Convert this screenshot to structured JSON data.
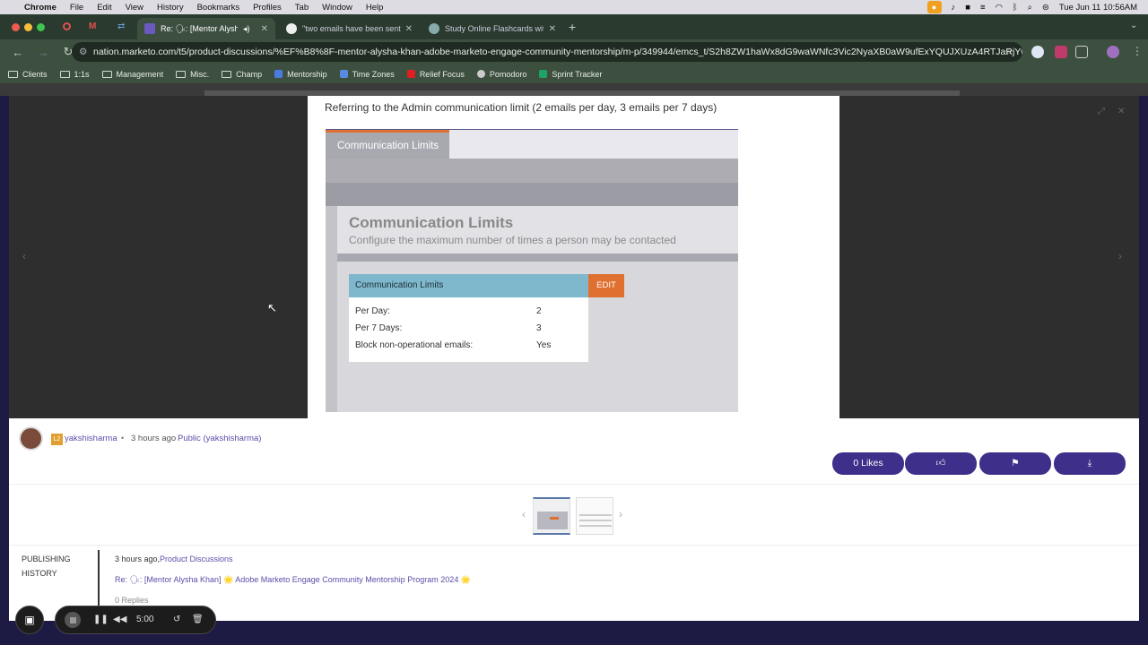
{
  "menubar": {
    "app": "Chrome",
    "items": [
      "File",
      "Edit",
      "View",
      "History",
      "Bookmarks",
      "Profiles",
      "Tab",
      "Window",
      "Help"
    ],
    "datetime": "Tue Jun 11  10:56AM"
  },
  "tabs": [
    {
      "label": "Re: 🗣: [Mentor Alysha Kh"
    },
    {
      "label": "\"two emails have been sent t"
    },
    {
      "label": "Study Online Flashcards with"
    }
  ],
  "address": {
    "url": "nation.marketo.com/t5/product-discussions/%EF%B8%8F-mentor-alysha-khan-adobe-marketo-engage-community-mentorship/m-p/349944/emcs_t/S2h8ZW1haWx8dG9waWNfc3Vic2NyaXB0aW9ufExYQUJXUzA4RTJaRjYwfD..."
  },
  "bookmarks": [
    {
      "label": "Clients",
      "icon": "folder-icon"
    },
    {
      "label": "1:1s",
      "icon": "folder-icon"
    },
    {
      "label": "Management",
      "icon": "folder-icon"
    },
    {
      "label": "Misc.",
      "icon": "folder-icon"
    },
    {
      "label": "Champ",
      "icon": "folder-icon"
    },
    {
      "label": "Mentorship",
      "icon": "doc-icon"
    },
    {
      "label": "Time Zones",
      "icon": "clock-icon"
    },
    {
      "label": "Relief Focus",
      "icon": "youtube-icon"
    },
    {
      "label": "Pomodoro",
      "icon": "check-icon"
    },
    {
      "label": "Sprint Tracker",
      "icon": "sheet-icon"
    }
  ],
  "image": {
    "caption": "Referring to the Admin communication limit (2 emails per day, 3 emails per 7 days)",
    "tab": "Communication Limits",
    "heading": "Communication Limits",
    "subheading": "Configure the maximum number of times a person may be contacted",
    "card_title": "Communication Limits",
    "edit": "EDIT",
    "rows": [
      {
        "label": "Per Day:",
        "value": "2"
      },
      {
        "label": "Per 7 Days:",
        "value": "3"
      },
      {
        "label": "Block non-operational emails:",
        "value": "Yes"
      }
    ]
  },
  "author": {
    "rank": "L2",
    "name": "yakshisharma",
    "time": "3 hours ago",
    "visibility": "Public (yakshisharma)"
  },
  "actions": {
    "likes": "0 Likes"
  },
  "history": {
    "label_line1": "PUBLISHING",
    "label_line2": "HISTORY",
    "time": "3 hours ago,",
    "board": "Product Discussions",
    "title": "Re: 🗣: [Mentor Alysha Khan] 🌟 Adobe Marketo Engage Community Mentorship Program 2024 🌟",
    "replies": "0 Replies"
  },
  "recorder": {
    "timer": "5:00"
  },
  "colors": {
    "accent": "#3d2f8a",
    "edit_orange": "#e07030",
    "card_header": "#7fb8cc"
  }
}
